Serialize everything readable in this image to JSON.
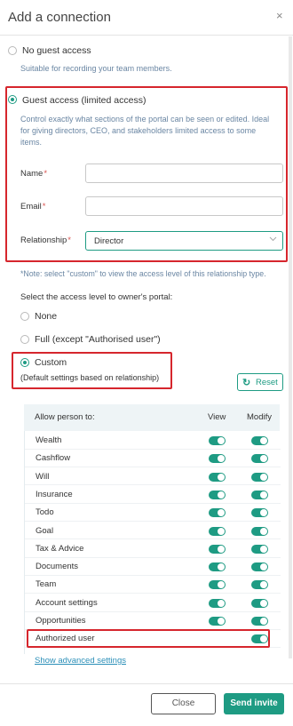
{
  "dialog": {
    "title": "Add a connection",
    "close_symbol": "×"
  },
  "access": {
    "no_guest": {
      "label": "No guest access",
      "description": "Suitable for recording your team members.",
      "checked": false
    },
    "guest": {
      "label": "Guest access (limited access)",
      "description_line1": "Control exactly what sections of the portal can be seen or edited. Ideal",
      "description_line2": "for giving directors, CEO, and stakeholders limited access to some",
      "description_line3": "items.",
      "checked": true
    }
  },
  "form": {
    "name_label": "Name",
    "email_label": "Email",
    "relationship_label": "Relationship",
    "required_mark": "*",
    "name_value": "",
    "email_value": "",
    "relationship_value": "Director"
  },
  "note": "*Note: select \"custom\" to view the access level of this relationship type.",
  "access_level": {
    "heading": "Select the access level to owner's portal:",
    "options": [
      {
        "label": "None",
        "checked": false
      },
      {
        "label": "Full (except \"Authorised user\")",
        "checked": false
      },
      {
        "label": "Custom",
        "checked": true
      }
    ],
    "custom_sub": "(Default settings based on relationship)",
    "reset_label": "Reset",
    "reset_icon": "refresh-icon"
  },
  "permissions": {
    "header": {
      "col_allow": "Allow person to:",
      "col_view": "View",
      "col_modify": "Modify"
    },
    "rows": [
      {
        "label": "Wealth",
        "view": true,
        "modify": true
      },
      {
        "label": "Cashflow",
        "view": true,
        "modify": true
      },
      {
        "label": "Will",
        "view": true,
        "modify": true
      },
      {
        "label": "Insurance",
        "view": true,
        "modify": true
      },
      {
        "label": "Todo",
        "view": true,
        "modify": true
      },
      {
        "label": "Goal",
        "view": true,
        "modify": true
      },
      {
        "label": "Tax & Advice",
        "view": true,
        "modify": true
      },
      {
        "label": "Documents",
        "view": true,
        "modify": true
      },
      {
        "label": "Team",
        "view": true,
        "modify": true
      },
      {
        "label": "Account settings",
        "view": true,
        "modify": true
      },
      {
        "label": "Opportunities",
        "view": true,
        "modify": true
      },
      {
        "label": "Authorized user",
        "view": null,
        "modify": true
      }
    ]
  },
  "advanced_link": "Show advanced settings",
  "footer": {
    "close_label": "Close",
    "send_label": "Send invite"
  },
  "colors": {
    "accent": "#1e9b83",
    "highlight": "#d6262d",
    "link": "#2b8fb8"
  }
}
